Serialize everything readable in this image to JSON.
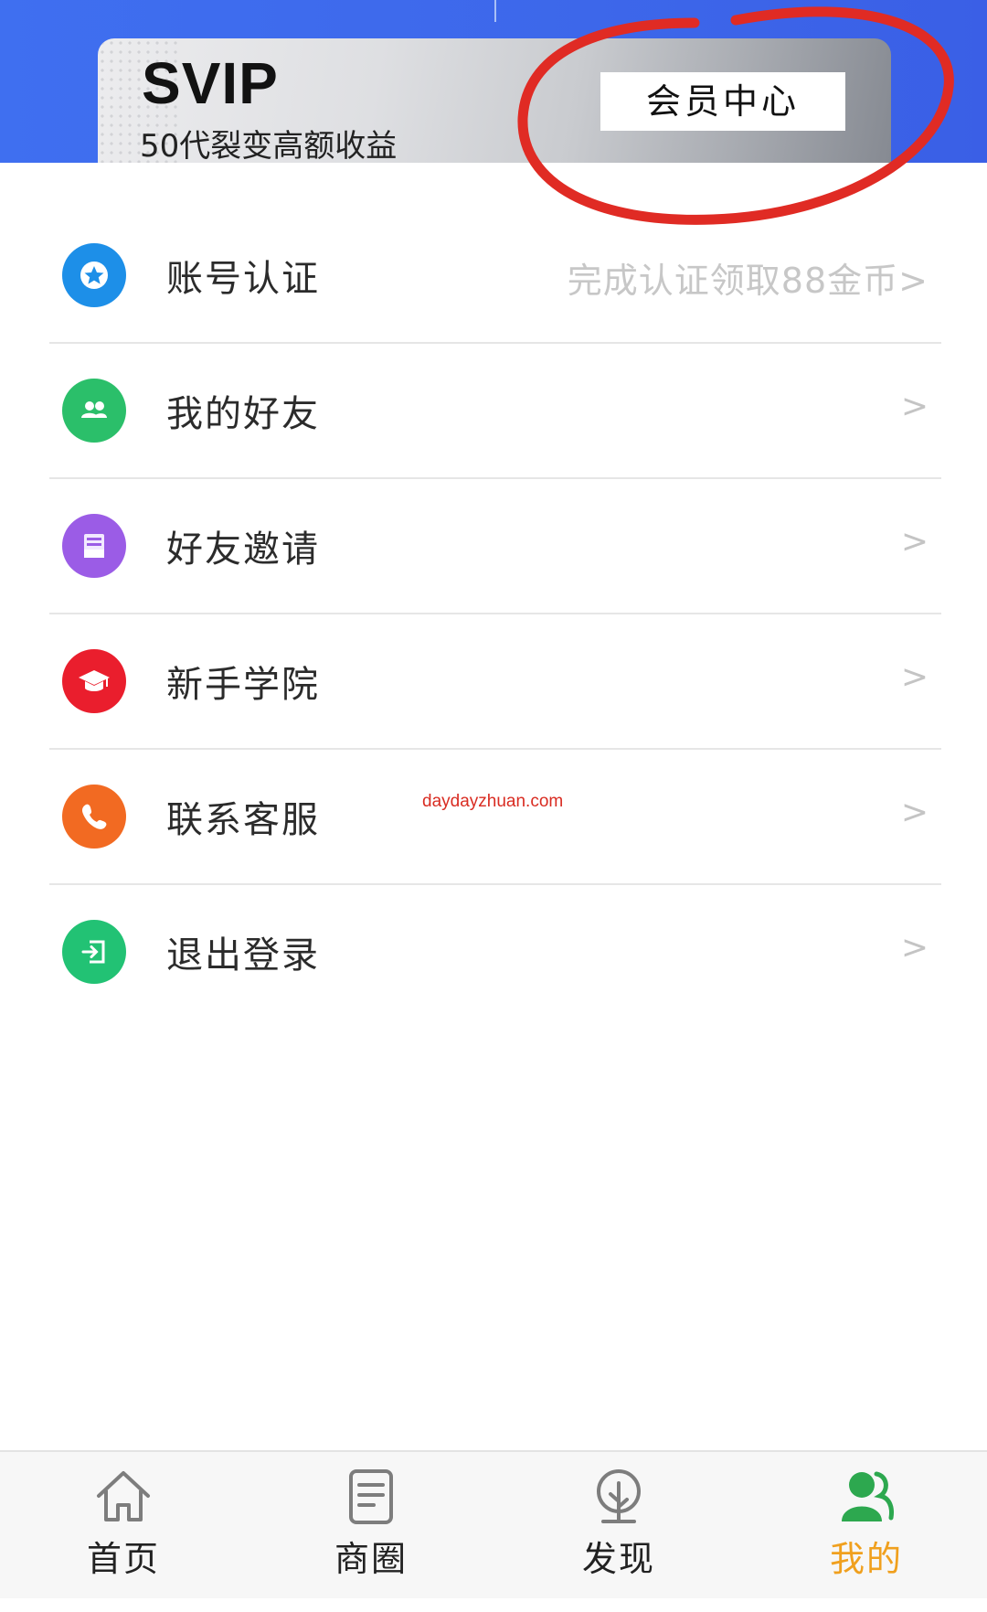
{
  "header": {
    "svip": {
      "title": "SVIP",
      "subtitle": "50代裂变高额收益",
      "member_center_label": "会员中心"
    }
  },
  "menu": {
    "items": [
      {
        "label": "账号认证",
        "hint": "完成认证领取88金币>",
        "icon": "star-badge-icon",
        "color": "#1d8fe8"
      },
      {
        "label": "我的好友",
        "chevron": ">",
        "icon": "friends-icon",
        "color": "#2bbf6a"
      },
      {
        "label": "好友邀请",
        "chevron": ">",
        "icon": "invite-card-icon",
        "color": "#9b5ce6"
      },
      {
        "label": "新手学院",
        "chevron": ">",
        "icon": "graduation-cap-icon",
        "color": "#ea1e2d"
      },
      {
        "label": "联系客服",
        "chevron": ">",
        "icon": "phone-icon",
        "color": "#f26a22"
      },
      {
        "label": "退出登录",
        "chevron": ">",
        "icon": "logout-icon",
        "color": "#22c274"
      }
    ]
  },
  "watermark": "daydayzhuan.com",
  "bottom_nav": {
    "items": [
      {
        "label": "首页",
        "icon": "home-icon"
      },
      {
        "label": "商圈",
        "icon": "document-icon"
      },
      {
        "label": "发现",
        "icon": "tree-icon"
      },
      {
        "label": "我的",
        "icon": "user-group-icon",
        "active": true
      }
    ],
    "active_color": "#f0a01e"
  },
  "colors": {
    "header_blue": "#3d67ea",
    "annotation_red": "#e02b24"
  }
}
